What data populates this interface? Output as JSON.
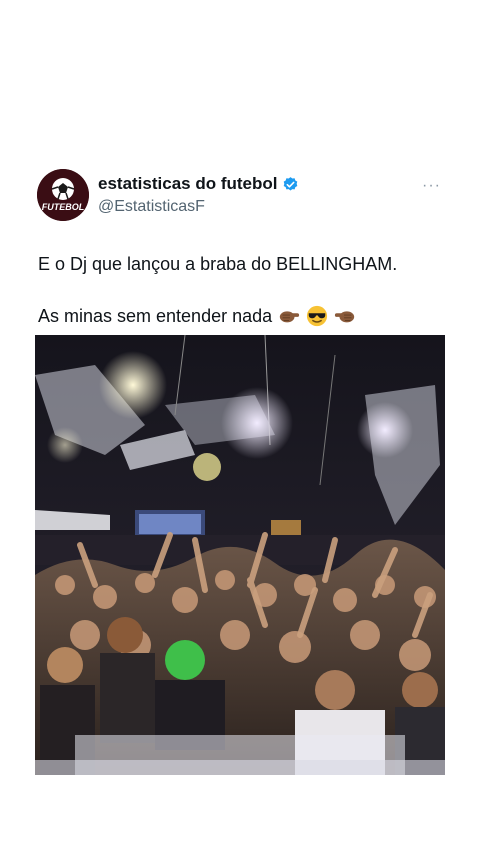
{
  "tweet": {
    "display_name": "estatisticas do futebol",
    "handle": "@EstatisticasF",
    "avatar_text": "FUTEBOL",
    "verified_icon": "verified-badge-icon",
    "more_icon": "more-dots-icon",
    "more_label": "···",
    "text_line1": "E o Dj que lançou a braba do BELLINGHAM.",
    "text_line2": "As minas sem entender nada",
    "emojis": [
      "point-right-hand-icon",
      "sunglasses-face-icon",
      "point-left-hand-icon"
    ]
  },
  "colors": {
    "verified": "#1d9bf0",
    "handle": "#536471",
    "avatar_bg": "#3a0d14"
  }
}
